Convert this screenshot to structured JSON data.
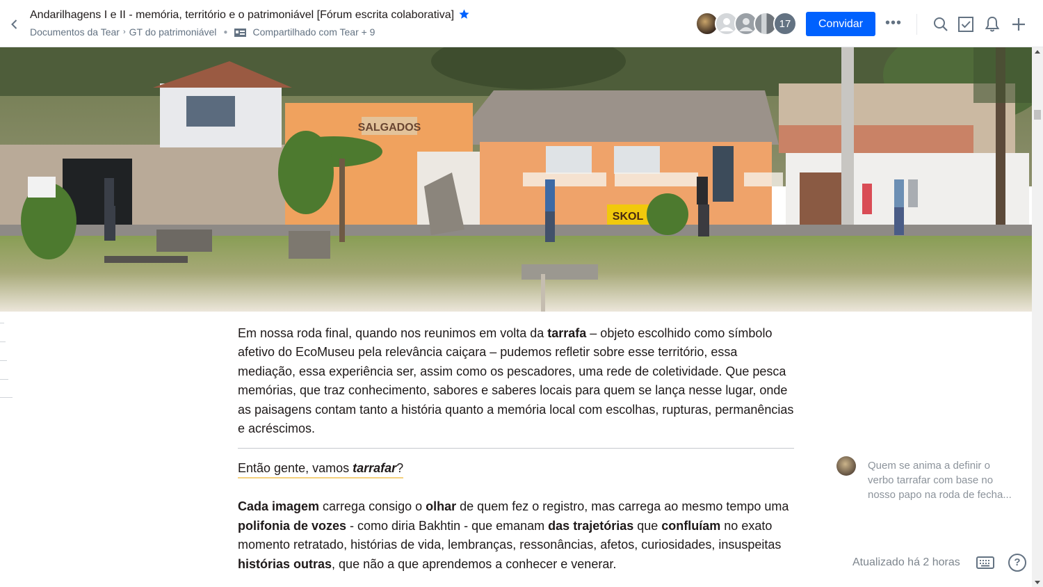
{
  "header": {
    "title": "Andarilhagens I e II - memória, território e o patrimoniável [Fórum escrita colaborativa]",
    "breadcrumb": {
      "folder": "Documentos da Tear",
      "separator": "›",
      "subfolder": "GT do patrimoniável",
      "shared": "Compartilhado com Tear + 9"
    },
    "avatar_count": "17",
    "invite_label": "Convidar",
    "more_label": "•••"
  },
  "icons": {
    "back": "chevron-left-icon",
    "star": "star-icon",
    "team": "team-icon",
    "search": "search-icon",
    "tasks": "checkbox-icon",
    "notifications": "bell-icon",
    "create": "plus-icon",
    "keyboard": "keyboard-icon",
    "help": "help-icon"
  },
  "colors": {
    "accent": "#0061fe",
    "highlight": "#f4d07c",
    "muted": "#637282"
  },
  "document": {
    "p1": {
      "a": "Em nossa roda final, quando nos reunimos em volta da ",
      "b": "tarrafa",
      "c": " – objeto escolhido como símbolo afetivo do EcoMuseu pela relevância caiçara – pudemos refletir sobre esse território, essa mediação, essa experiência ser, assim como os pescadores, uma rede de coletividade. Que pesca memórias, que traz conhecimento, sabores e saberes locais para quem se lança nesse lugar, onde as paisagens contam tanto a história quanto a memória local com escolhas, rupturas, permanências e acréscimos."
    },
    "question": {
      "a": "Então gente, vamos ",
      "b": "tarrafar",
      "c": "?"
    },
    "p2": {
      "s1": "Cada imagem",
      "s2": " carrega consigo o ",
      "s3": "olhar",
      "s4": " de quem fez o registro, mas carrega ao mesmo tempo uma ",
      "s5": "polifonia de vozes",
      "s6": " - como diria Bakhtin - que emanam ",
      "s7": "das trajetórias",
      "s8": " que ",
      "s9": "confluíam",
      "s10": " no exato momento retratado, histórias de vida, lembranças, ressonâncias, afetos, curiosidades, insuspeitas ",
      "s11": "histórias outras",
      "s12": ", que não a que aprendemos a conhecer e venerar."
    }
  },
  "comment": {
    "text": "Quem se anima a definir o verbo tarrafar com base no nosso papo na roda de fecha..."
  },
  "footer": {
    "updated": "Atualizado há 2 horas",
    "help_label": "?"
  },
  "cover_image": {
    "sign_text": "SKOL",
    "shop_text": "SALGADOS"
  }
}
